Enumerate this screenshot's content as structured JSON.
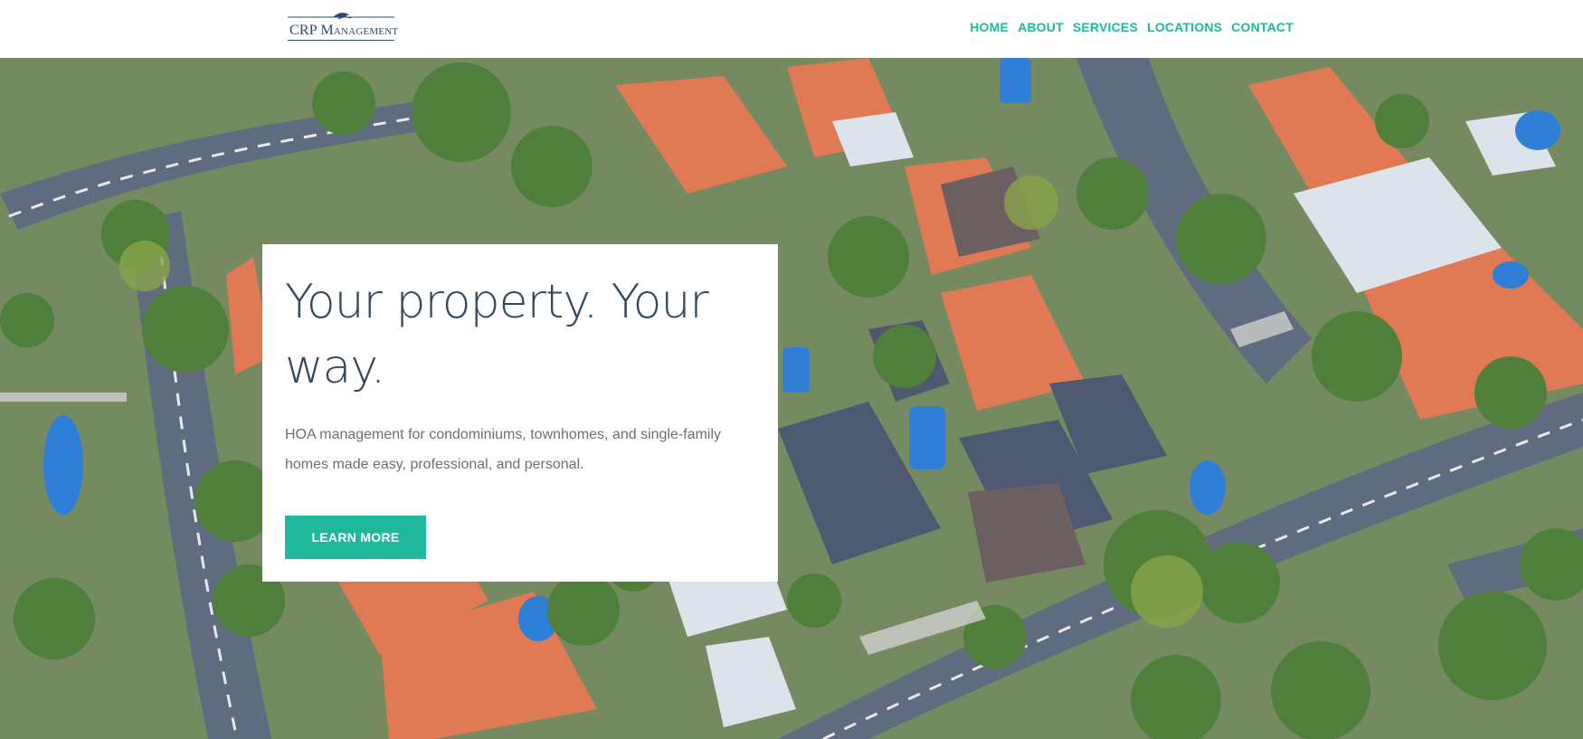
{
  "brand": {
    "logo_text": "CRP Management",
    "accent_color": "#1fb89a",
    "logo_color": "#2a4a78"
  },
  "nav": {
    "items": [
      "HOME",
      "ABOUT",
      "SERVICES",
      "LOCATIONS",
      "CONTACT"
    ]
  },
  "hero": {
    "background": "aerial-neighborhood-photo",
    "title": "Your property. Your way.",
    "description": "HOA management for condominiums, townhomes, and single-family homes made easy, professional, and personal.",
    "cta_label": "LEARN MORE"
  }
}
